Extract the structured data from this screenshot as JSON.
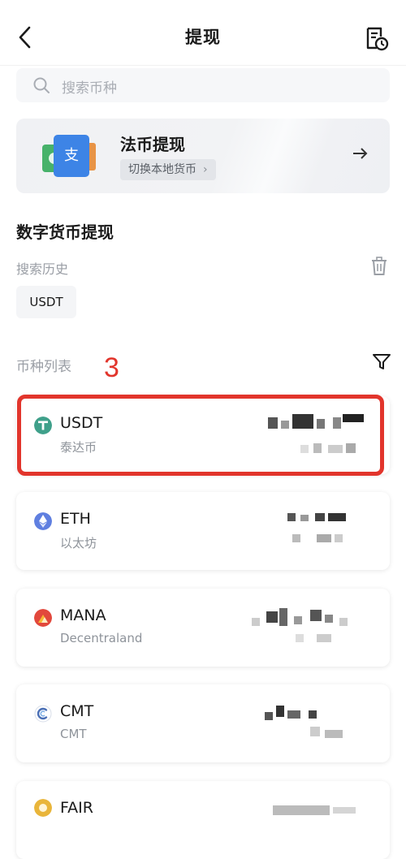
{
  "header": {
    "title": "提现",
    "back_icon": "chevron-left-icon",
    "record_icon": "document-clock-icon"
  },
  "search": {
    "placeholder": "搜索币种"
  },
  "fiat": {
    "title": "法币提现",
    "switch_label": "切换本地货币"
  },
  "section": {
    "title": "数字货币提现",
    "history_label": "搜索历史",
    "history_chips": [
      "USDT"
    ]
  },
  "coin_list": {
    "label": "币种列表",
    "annotation": "3",
    "coins": [
      {
        "symbol": "USDT",
        "name": "泰达币",
        "icon_color": "#3fa08a"
      },
      {
        "symbol": "ETH",
        "name": "以太坊",
        "icon_color": "#5f7fe0"
      },
      {
        "symbol": "MANA",
        "name": "Decentraland",
        "icon_color": "#e2483c"
      },
      {
        "symbol": "CMT",
        "name": "CMT",
        "icon_color": "#4a6fb5"
      },
      {
        "symbol": "FAIR",
        "name": "",
        "icon_color": "#e9b53a"
      }
    ]
  },
  "colors": {
    "accent_red": "#e2352c",
    "text_primary": "#1a1a1a",
    "text_secondary": "#8e939a"
  }
}
